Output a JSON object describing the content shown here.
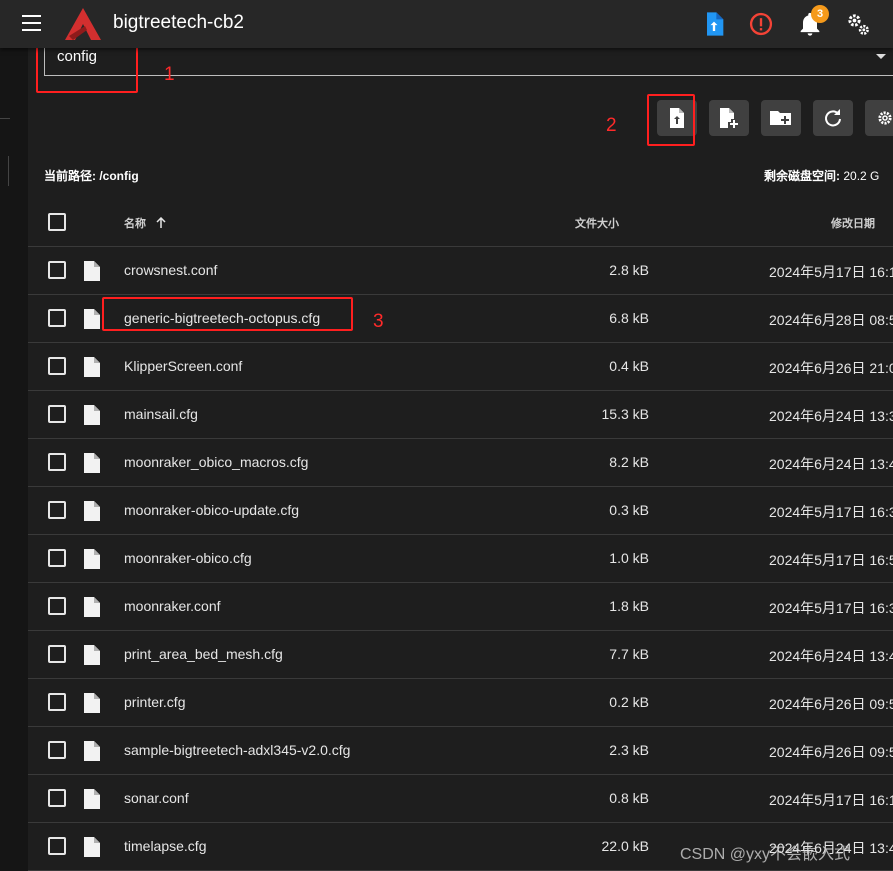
{
  "app": {
    "title": "bigtreetech-cb2",
    "notification_count": "3"
  },
  "file_manager": {
    "root_value": "config",
    "current_path_label": "当前路径:",
    "current_path": "/config",
    "disk_label": "剩余磁盘空间:",
    "disk_value": "20.2 G",
    "columns": {
      "name": "名称",
      "size": "文件大小",
      "modified": "修改日期"
    },
    "files": [
      {
        "name": "crowsnest.conf",
        "size": "2.8 kB",
        "modified": "2024年5月17日 16:1"
      },
      {
        "name": "generic-bigtreetech-octopus.cfg",
        "size": "6.8 kB",
        "modified": "2024年6月28日 08:5"
      },
      {
        "name": "KlipperScreen.conf",
        "size": "0.4 kB",
        "modified": "2024年6月26日 21:0"
      },
      {
        "name": "mainsail.cfg",
        "size": "15.3 kB",
        "modified": "2024年6月24日 13:3"
      },
      {
        "name": "moonraker_obico_macros.cfg",
        "size": "8.2 kB",
        "modified": "2024年6月24日 13:4"
      },
      {
        "name": "moonraker-obico-update.cfg",
        "size": "0.3 kB",
        "modified": "2024年5月17日 16:3"
      },
      {
        "name": "moonraker-obico.cfg",
        "size": "1.0 kB",
        "modified": "2024年5月17日 16:5"
      },
      {
        "name": "moonraker.conf",
        "size": "1.8 kB",
        "modified": "2024年5月17日 16:3"
      },
      {
        "name": "print_area_bed_mesh.cfg",
        "size": "7.7 kB",
        "modified": "2024年6月24日 13:4"
      },
      {
        "name": "printer.cfg",
        "size": "0.2 kB",
        "modified": "2024年6月26日 09:5"
      },
      {
        "name": "sample-bigtreetech-adxl345-v2.0.cfg",
        "size": "2.3 kB",
        "modified": "2024年6月26日 09:5"
      },
      {
        "name": "sonar.conf",
        "size": "0.8 kB",
        "modified": "2024年5月17日 16:1"
      },
      {
        "name": "timelapse.cfg",
        "size": "22.0 kB",
        "modified": "2024年6月24日 13:4"
      }
    ]
  },
  "annotations": {
    "one": "1",
    "two": "2",
    "three": "3"
  },
  "watermark": "CSDN @yxy不会嵌入式",
  "colors": {
    "accent": "#2196f3",
    "error": "#f44336",
    "badge": "#f59a1b",
    "annotation": "#ff1f1f"
  }
}
